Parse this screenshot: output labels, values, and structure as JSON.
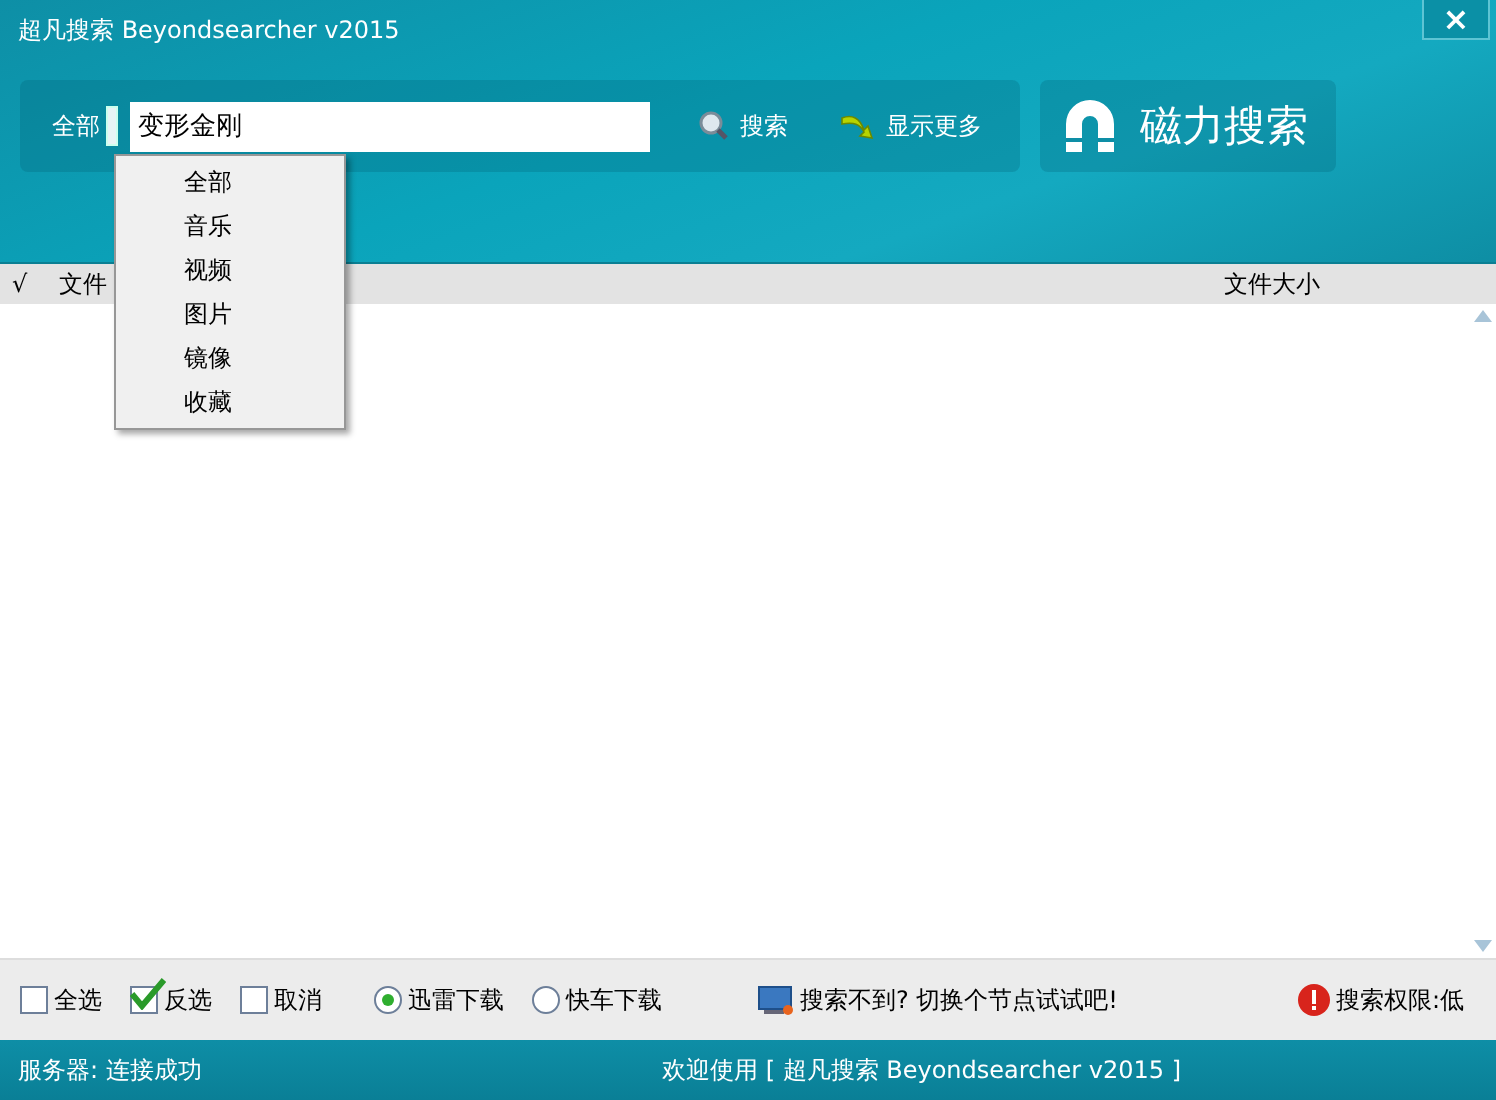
{
  "window": {
    "title": "超凡搜索 Beyondsearcher v2015",
    "close": "×"
  },
  "search": {
    "category": "全部",
    "value": "变形金刚",
    "search_button": "搜索",
    "more_button": "显示更多",
    "magnet_button": "磁力搜索"
  },
  "category_menu": {
    "items": [
      {
        "label": "全部",
        "selected": false
      },
      {
        "label": "音乐",
        "selected": false
      },
      {
        "label": "视频",
        "selected": false
      },
      {
        "label": "图片",
        "selected": false
      },
      {
        "label": "镜像",
        "selected": false
      },
      {
        "label": "收藏",
        "selected": false
      }
    ]
  },
  "table": {
    "columns": [
      "√",
      "文件",
      "文件大小"
    ]
  },
  "toolbar": {
    "checks": [
      {
        "label": "全选",
        "checked": false
      },
      {
        "label": "反选",
        "checked": true
      },
      {
        "label": "取消",
        "checked": false
      }
    ],
    "downloaders": [
      {
        "label": "迅雷下载",
        "selected": true
      },
      {
        "label": "快车下载",
        "selected": false
      }
    ],
    "hint": "搜索不到? 切换个节点试试吧!",
    "permission": "搜索权限:低"
  },
  "status_bar": {
    "server": "服务器: 连接成功",
    "welcome": "欢迎使用 [ 超凡搜索 Beyondsearcher v2015 ]"
  }
}
